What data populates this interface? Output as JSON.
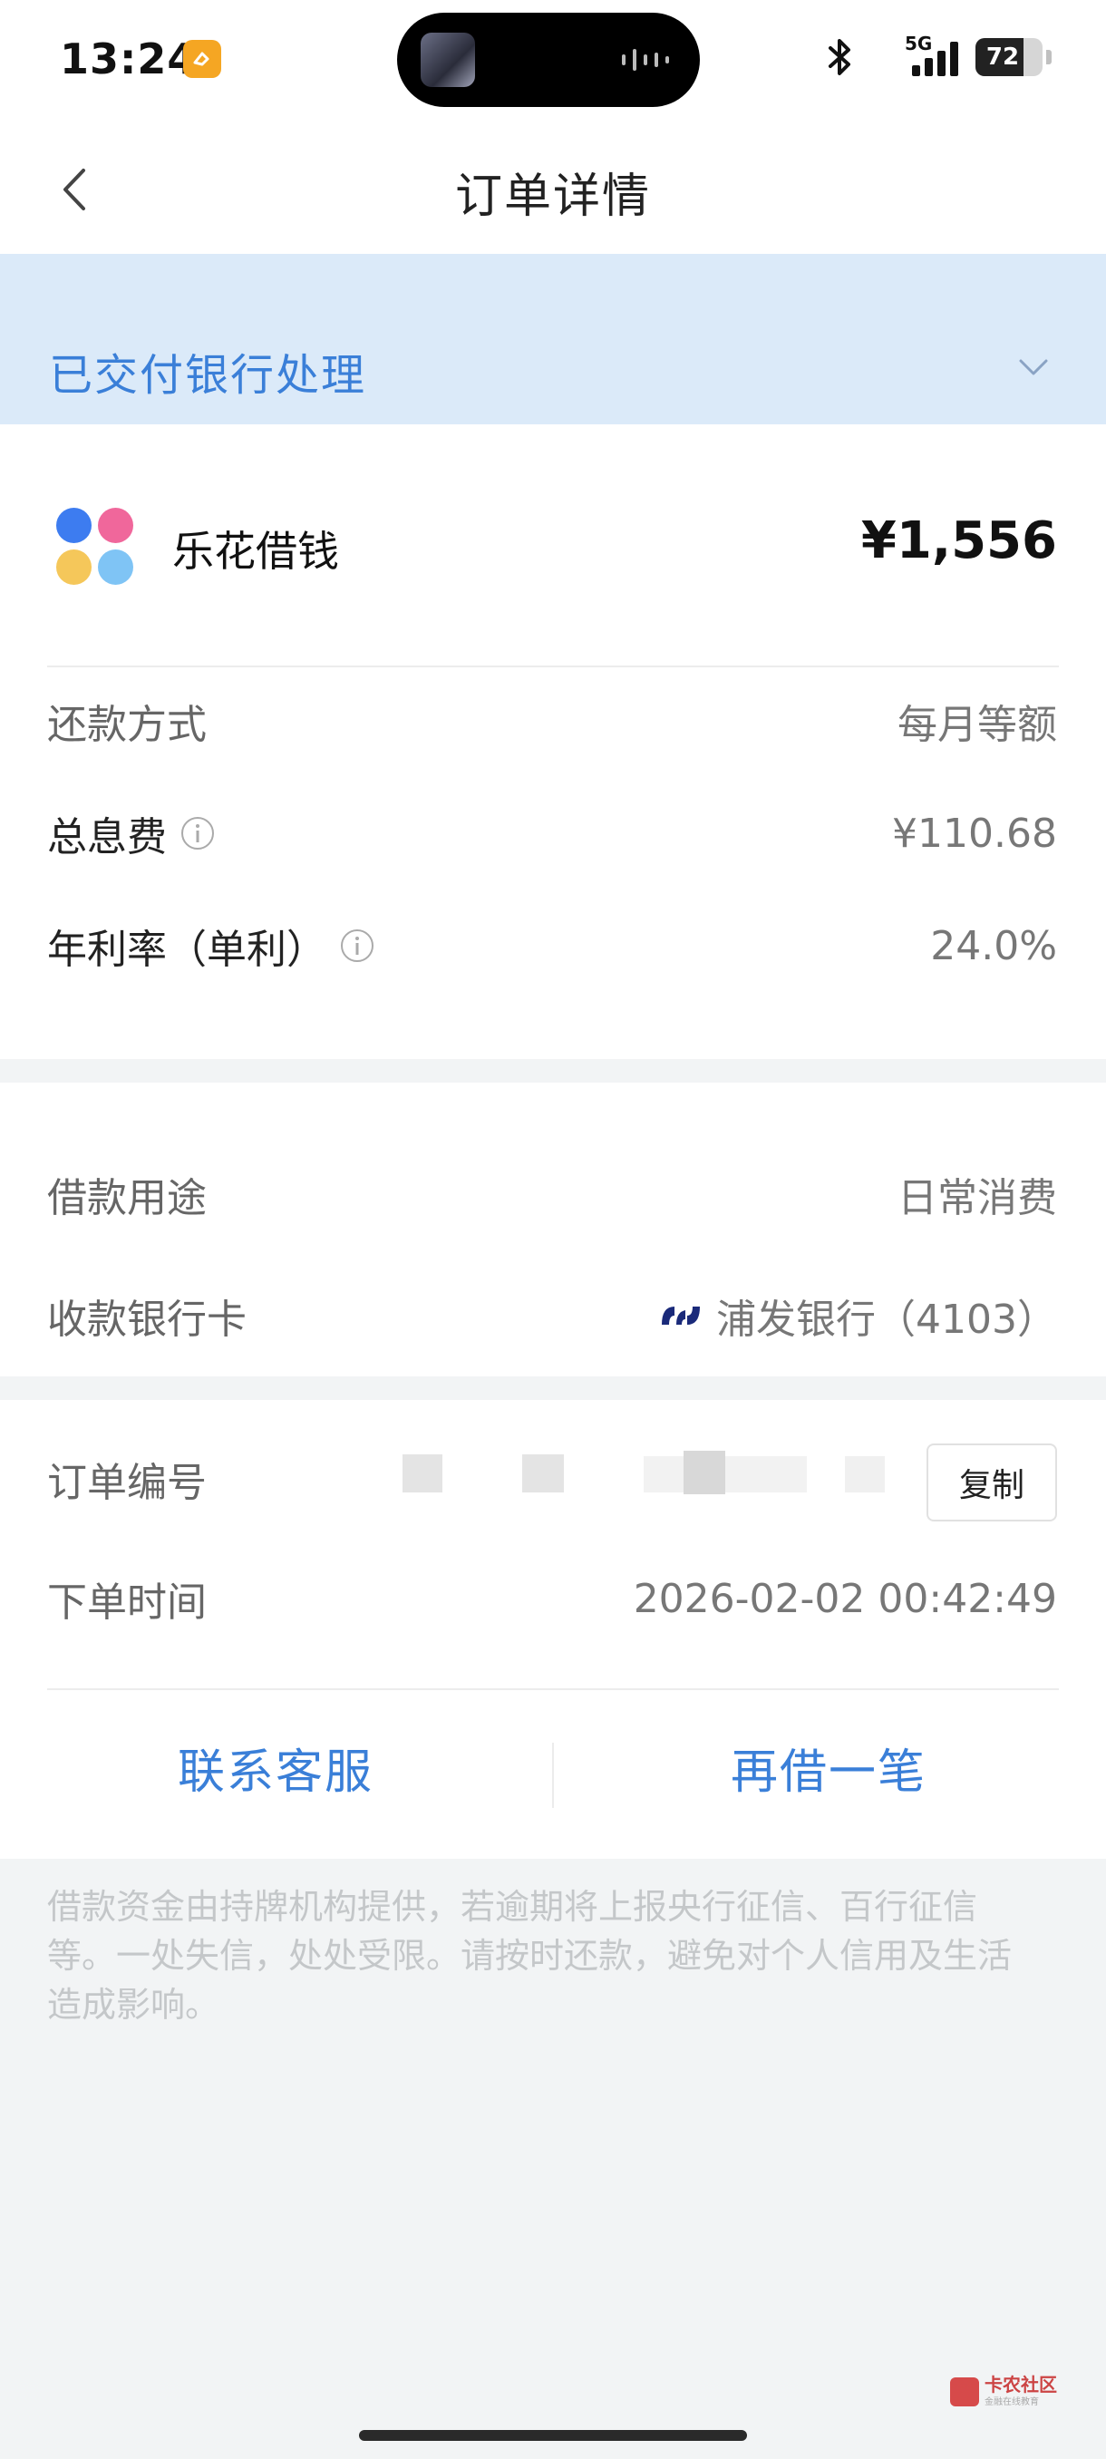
{
  "status_bar": {
    "time": "13:24",
    "network": "5G",
    "battery": "72",
    "battery_level": 0.72,
    "icons": [
      "app-badge-icon",
      "bluetooth-icon",
      "signal-icon",
      "battery-icon"
    ]
  },
  "nav": {
    "title": "订单详情",
    "back_icon": "chevron-left-icon"
  },
  "banner": {
    "status_text": "已交付银行处理",
    "chevron_icon": "chevron-down-icon"
  },
  "product": {
    "name": "乐花借钱",
    "amount": "¥1,556",
    "logo_colors": [
      "#3d7cf0",
      "#f0679b",
      "#f5c75a",
      "#7fc4f5"
    ]
  },
  "details": {
    "repay_method": {
      "label": "还款方式",
      "value": "每月等额"
    },
    "total_interest": {
      "label": "总息费",
      "value": "¥110.68"
    },
    "annual_rate": {
      "label": "年利率（单利）",
      "value": "24.0%"
    }
  },
  "loan": {
    "purpose": {
      "label": "借款用途",
      "value": "日常消费"
    },
    "bank_card": {
      "label": "收款银行卡",
      "value": "浦发银行（4103）"
    }
  },
  "order": {
    "number_label": "订单编号",
    "copy_label": "复制",
    "time_label": "下单时间",
    "time_value": "2026-02-02 00:42:49"
  },
  "actions": {
    "contact": "联系客服",
    "borrow_again": "再借一笔"
  },
  "disclaimer": "借款资金由持牌机构提供，若逾期将上报央行征信、百行征信等。一处失信，处处受限。请按时还款，避免对个人信用及生活造成影响。",
  "watermark": {
    "name": "卡农社区",
    "sub": "金融在线教育"
  },
  "colors": {
    "accent": "#3a7fd8",
    "banner_bg": "#dbeaf9",
    "page_bg": "#f2f4f5"
  }
}
